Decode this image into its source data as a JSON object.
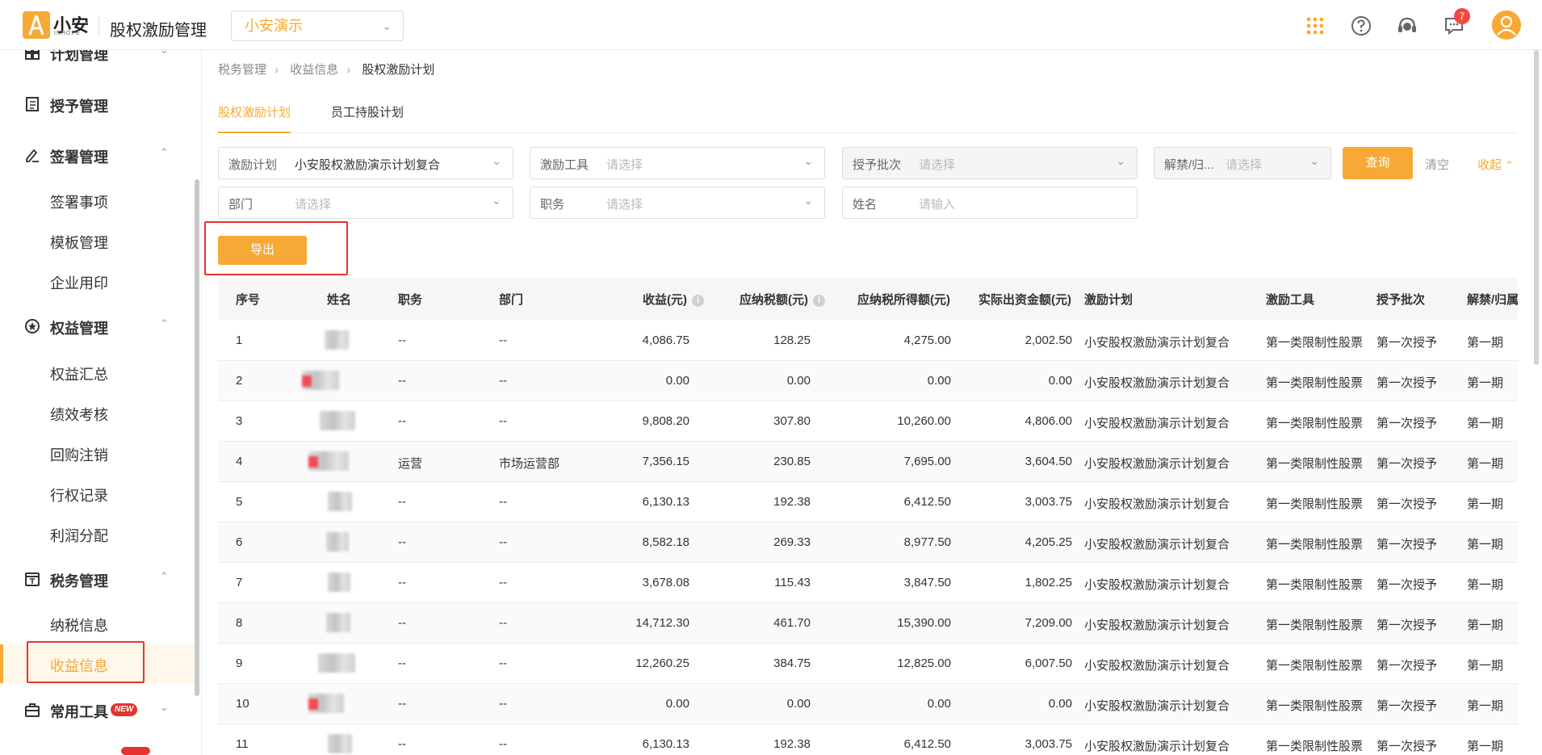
{
  "header": {
    "logo_text": "小安",
    "logo_sub": "INHOPE",
    "app_title": "股权激励管理",
    "company": "小安演示",
    "message_count": "7",
    "colors": {
      "accent": "#f7a935",
      "badge": "#f04a3f"
    },
    "icons": [
      "apps-grid-icon",
      "help-icon",
      "support-headset-icon",
      "message-icon",
      "user-avatar-icon"
    ]
  },
  "sidebar": {
    "groups": [
      {
        "label": "计划管理",
        "icon": "plan-grid-icon",
        "expanded": false
      },
      {
        "label": "授予管理",
        "icon": "grant-book-icon"
      },
      {
        "label": "签署管理",
        "icon": "sign-pen-icon",
        "expanded": true,
        "items": [
          "签署事项",
          "模板管理",
          "企业用印"
        ]
      },
      {
        "label": "权益管理",
        "icon": "equity-badge-icon",
        "expanded": true,
        "items": [
          "权益汇总",
          "绩效考核",
          "回购注销",
          "行权记录",
          "利润分配"
        ]
      },
      {
        "label": "税务管理",
        "icon": "tax-icon",
        "expanded": true,
        "items": [
          "纳税信息",
          "收益信息"
        ]
      },
      {
        "label": "常用工具",
        "icon": "toolbox-icon",
        "tag": "NEW",
        "expanded": false
      }
    ],
    "active_item": "收益信息"
  },
  "breadcrumb": [
    "税务管理",
    "收益信息",
    "股权激励计划"
  ],
  "tabs": [
    {
      "label": "股权激励计划",
      "active": true
    },
    {
      "label": "员工持股计划",
      "active": false
    }
  ],
  "filters": {
    "plan": {
      "label": "激励计划",
      "value": "小安股权激励演示计划复合"
    },
    "tool": {
      "label": "激励工具",
      "placeholder": "请选择"
    },
    "batch": {
      "label": "授予批次",
      "placeholder": "请选择"
    },
    "unlock": {
      "label": "解禁/归...",
      "placeholder": "请选择"
    },
    "dept": {
      "label": "部门",
      "placeholder": "请选择"
    },
    "position": {
      "label": "职务",
      "placeholder": "请选择"
    },
    "name": {
      "label": "姓名",
      "placeholder": "请输入"
    }
  },
  "actions": {
    "query": "查询",
    "clear": "清空",
    "collapse": "收起",
    "export": "导出"
  },
  "table": {
    "columns": [
      "序号",
      "姓名",
      "职务",
      "部门",
      "收益(元)",
      "应纳税额(元)",
      "应纳税所得额(元)",
      "实际出资金额(元)",
      "激励计划",
      "激励工具",
      "授予批次",
      "解禁/归属"
    ],
    "rows": [
      {
        "no": "1",
        "position": "--",
        "dept": "--",
        "income": "4,086.75",
        "tax": "128.25",
        "taxable": "4,275.00",
        "paid": "2,002.50",
        "plan": "小安股权激励演示计划复合",
        "tool": "第一类限制性股票",
        "batch": "第一次授予",
        "period": "第一期"
      },
      {
        "no": "2",
        "position": "--",
        "dept": "--",
        "income": "0.00",
        "tax": "0.00",
        "taxable": "0.00",
        "paid": "0.00",
        "plan": "小安股权激励演示计划复合",
        "tool": "第一类限制性股票",
        "batch": "第一次授予",
        "period": "第一期"
      },
      {
        "no": "3",
        "position": "--",
        "dept": "--",
        "income": "9,808.20",
        "tax": "307.80",
        "taxable": "10,260.00",
        "paid": "4,806.00",
        "plan": "小安股权激励演示计划复合",
        "tool": "第一类限制性股票",
        "batch": "第一次授予",
        "period": "第一期"
      },
      {
        "no": "4",
        "position": "运营",
        "dept": "市场运营部",
        "income": "7,356.15",
        "tax": "230.85",
        "taxable": "7,695.00",
        "paid": "3,604.50",
        "plan": "小安股权激励演示计划复合",
        "tool": "第一类限制性股票",
        "batch": "第一次授予",
        "period": "第一期"
      },
      {
        "no": "5",
        "position": "--",
        "dept": "--",
        "income": "6,130.13",
        "tax": "192.38",
        "taxable": "6,412.50",
        "paid": "3,003.75",
        "plan": "小安股权激励演示计划复合",
        "tool": "第一类限制性股票",
        "batch": "第一次授予",
        "period": "第一期"
      },
      {
        "no": "6",
        "position": "--",
        "dept": "--",
        "income": "8,582.18",
        "tax": "269.33",
        "taxable": "8,977.50",
        "paid": "4,205.25",
        "plan": "小安股权激励演示计划复合",
        "tool": "第一类限制性股票",
        "batch": "第一次授予",
        "period": "第一期"
      },
      {
        "no": "7",
        "position": "--",
        "dept": "--",
        "income": "3,678.08",
        "tax": "115.43",
        "taxable": "3,847.50",
        "paid": "1,802.25",
        "plan": "小安股权激励演示计划复合",
        "tool": "第一类限制性股票",
        "batch": "第一次授予",
        "period": "第一期"
      },
      {
        "no": "8",
        "position": "--",
        "dept": "--",
        "income": "14,712.30",
        "tax": "461.70",
        "taxable": "15,390.00",
        "paid": "7,209.00",
        "plan": "小安股权激励演示计划复合",
        "tool": "第一类限制性股票",
        "batch": "第一次授予",
        "period": "第一期"
      },
      {
        "no": "9",
        "position": "--",
        "dept": "--",
        "income": "12,260.25",
        "tax": "384.75",
        "taxable": "12,825.00",
        "paid": "6,007.50",
        "plan": "小安股权激励演示计划复合",
        "tool": "第一类限制性股票",
        "batch": "第一次授予",
        "period": "第一期"
      },
      {
        "no": "10",
        "position": "--",
        "dept": "--",
        "income": "0.00",
        "tax": "0.00",
        "taxable": "0.00",
        "paid": "0.00",
        "plan": "小安股权激励演示计划复合",
        "tool": "第一类限制性股票",
        "batch": "第一次授予",
        "period": "第一期"
      },
      {
        "no": "11",
        "position": "--",
        "dept": "--",
        "income": "6,130.13",
        "tax": "192.38",
        "taxable": "6,412.50",
        "paid": "3,003.75",
        "plan": "小安股权激励演示计划复合",
        "tool": "第一类限制性股票",
        "batch": "第一次授予",
        "period": "第一期"
      }
    ]
  }
}
